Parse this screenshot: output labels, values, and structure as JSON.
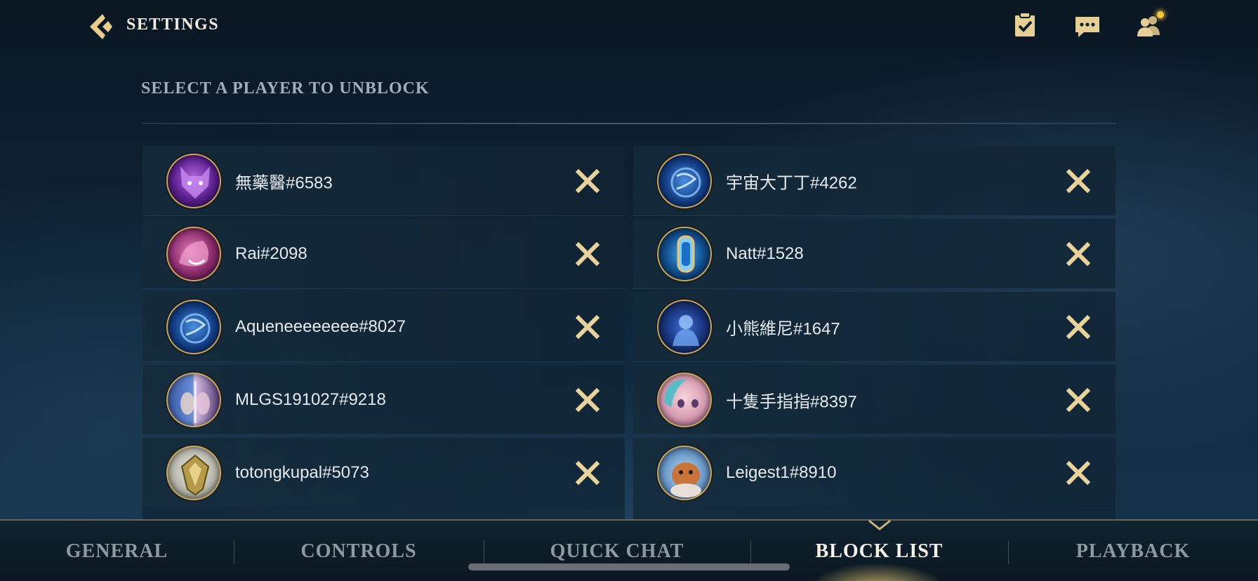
{
  "header": {
    "title": "SETTINGS",
    "section_title": "SELECT A PLAYER TO UNBLOCK"
  },
  "top_icons": [
    "checklist-icon",
    "chat-icon",
    "friends-icon"
  ],
  "blocked_players": [
    {
      "name": "無藥醫#6583",
      "avatar": "purple-beast"
    },
    {
      "name": "宇宙大丁丁#4262",
      "avatar": "blue-orb"
    },
    {
      "name": "Rai#2098",
      "avatar": "pink-beast"
    },
    {
      "name": "Natt#1528",
      "avatar": "blue-crystal"
    },
    {
      "name": "Aqueneeeeeeee#8027",
      "avatar": "blue-orb"
    },
    {
      "name": "小熊維尼#1647",
      "avatar": "blue-warrior"
    },
    {
      "name": "MLGS191027#9218",
      "avatar": "twin-faces"
    },
    {
      "name": "十隻手指指#8397",
      "avatar": "pink-face"
    },
    {
      "name": "totongkupal#5073",
      "avatar": "silver-emblem"
    },
    {
      "name": "Leigest1#8910",
      "avatar": "orange-creature"
    }
  ],
  "tabs": [
    {
      "label": "GENERAL",
      "active": false
    },
    {
      "label": "CONTROLS",
      "active": false
    },
    {
      "label": "QUICK CHAT",
      "active": false
    },
    {
      "label": "BLOCK LIST",
      "active": true
    },
    {
      "label": "PLAYBACK",
      "active": false
    }
  ],
  "colors": {
    "accent_gold": "#c7a65a",
    "notification": "#f3c542",
    "active_tab": "#f4f1e8",
    "inactive_tab": "#8d9aa0"
  }
}
